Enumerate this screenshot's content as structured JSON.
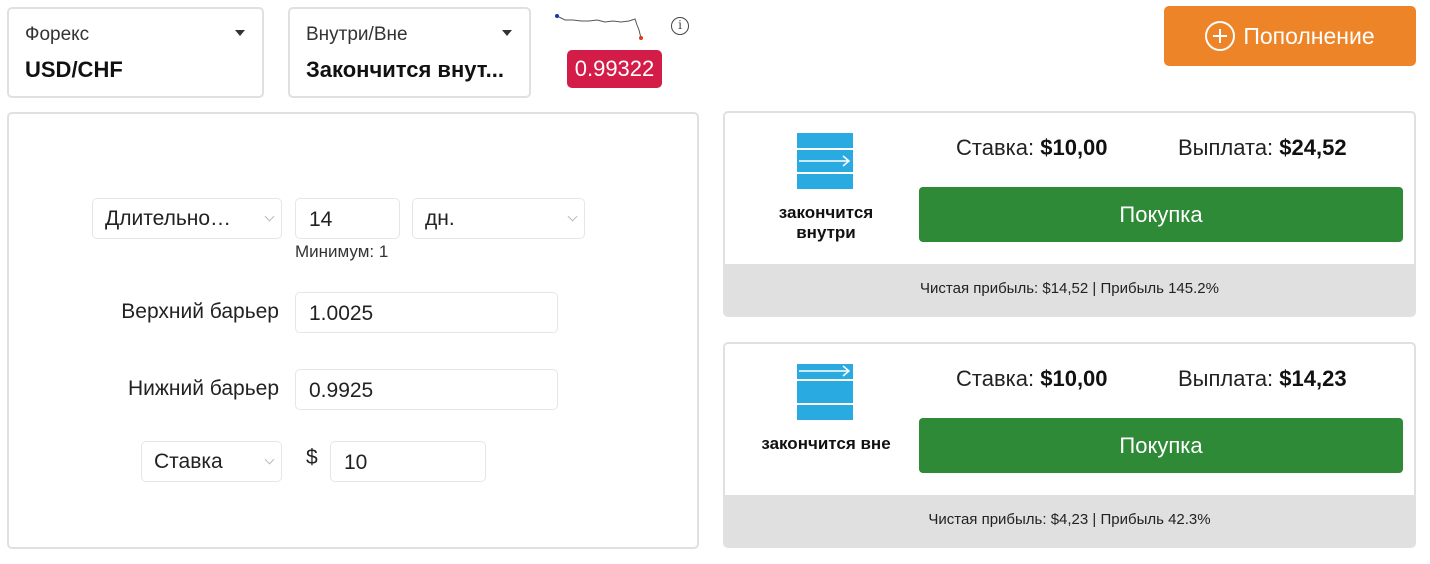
{
  "market": {
    "label": "Форекс",
    "value": "USD/CHF"
  },
  "contract_type": {
    "label": "Внутри/Вне",
    "value": "Закончится внут..."
  },
  "price": {
    "current": "0.99322",
    "color": "#d41c48"
  },
  "deposit": {
    "label": "Пополнение",
    "icon": "plus-circle-icon",
    "color": "#ee8428"
  },
  "form": {
    "duration_type": "Длительно…",
    "duration_value": "14",
    "duration_unit": "дн.",
    "duration_min": "Минимум: 1",
    "upper_barrier_label": "Верхний барьер",
    "upper_barrier_value": "1.0025",
    "lower_barrier_label": "Нижний барьер",
    "lower_barrier_value": "0.9925",
    "amount_type": "Ставка",
    "currency_symbol": "$",
    "amount_value": "10"
  },
  "options": [
    {
      "name": "закончится внутри",
      "stake_label": "Ставка:",
      "stake_value": "$10,00",
      "payout_label": "Выплата:",
      "payout_value": "$24,52",
      "buy_label": "Покупка",
      "profit_text": "Чистая прибыль: $14,52 | Прибыль 145.2%",
      "icon": "ends-inside-icon"
    },
    {
      "name": "закончится вне",
      "stake_label": "Ставка:",
      "stake_value": "$10,00",
      "payout_label": "Выплата:",
      "payout_value": "$14,23",
      "buy_label": "Покупка",
      "profit_text": "Чистая прибыль: $4,23 | Прибыль 42.3%",
      "icon": "ends-outside-icon"
    }
  ],
  "colors": {
    "buy": "#2f8a38",
    "icon_blue": "#29abe2",
    "panel_border": "#e0e0e0"
  }
}
